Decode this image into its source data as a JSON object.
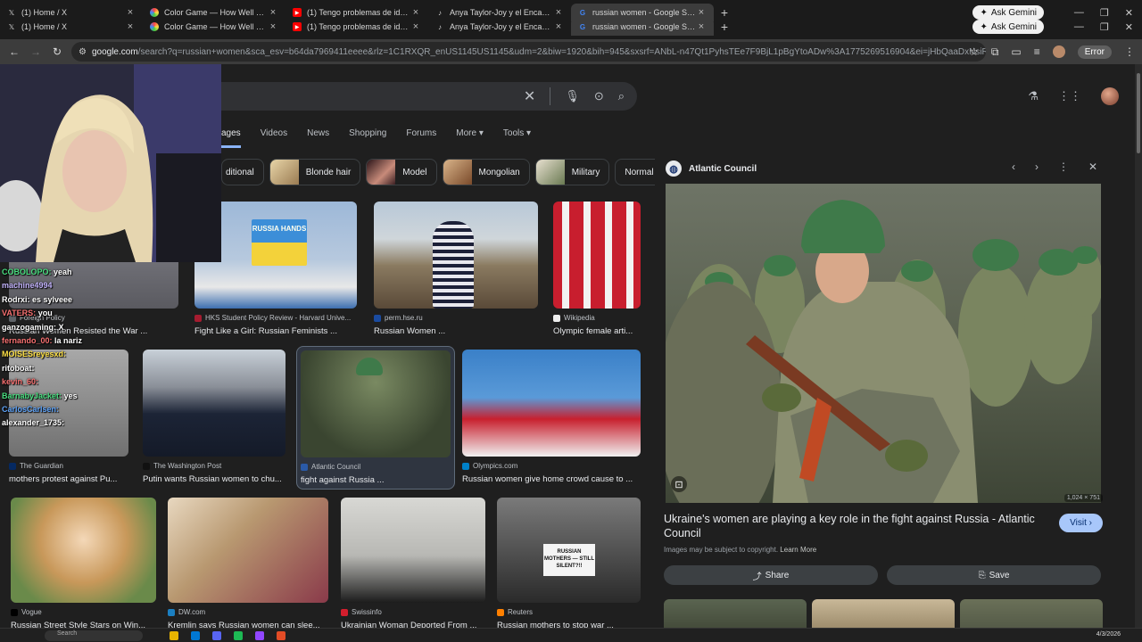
{
  "tabs": [
    {
      "title": "(1) Home / X",
      "icon": "x-logo-icon"
    },
    {
      "title": "Color Game — How Well Can Y",
      "icon": "color-game-icon"
    },
    {
      "title": "(1) Tengo problemas de identi",
      "icon": "youtube-icon"
    },
    {
      "title": "Anya Taylor-Joy y el Encanto d",
      "icon": "tiktok-icon"
    },
    {
      "title": "russian women - Google Search",
      "icon": "google-icon",
      "active": true
    }
  ],
  "ask_gemini": "Ask Gemini",
  "address": {
    "host": "google.com",
    "rest": "/search?q=russian+women&sca_esv=b64da7969411eeee&rlz=1C1RXQR_enUS1145US1145&udm=2&biw=1920&bih=945&sxsrf=ANbL-n47Qt1PyhsTEe7F9BjL1pBgYtoADw%3A1775269516904&ei=jHbQaaDxNsiRwbkP5LC..."
  },
  "error_label": "Error",
  "filters": [
    "Images",
    "Videos",
    "News",
    "Shopping",
    "Forums",
    "More",
    "Tools"
  ],
  "filter_visible_active": "ages",
  "chips": [
    {
      "label": "ditional",
      "color": "#8a6a4a"
    },
    {
      "label": "Blonde hair",
      "color": "#d8c7a0"
    },
    {
      "label": "Model",
      "color": "#4a2a30"
    },
    {
      "label": "Mongolian",
      "color": "#b58a5a"
    },
    {
      "label": "Military",
      "color": "#5a6a4a"
    },
    {
      "label": "Normal",
      "color": "#333"
    }
  ],
  "results_row1": [
    {
      "source": "Foreign Policy",
      "caption": "Russian Women Resisted the War ..."
    },
    {
      "source": "HKS Student Policy Review - Harvard Unive...",
      "caption": "Fight Like a Girl: Russian Feminists ..."
    },
    {
      "source": "perm.hse.ru",
      "caption": "Russian Women ..."
    },
    {
      "source": "Wikipedia",
      "caption": "Olympic female arti..."
    }
  ],
  "results_row2": [
    {
      "source": "The Guardian",
      "caption": "mothers protest against Pu..."
    },
    {
      "source": "The Washington Post",
      "caption": "Putin wants Russian women to chu..."
    },
    {
      "source": "Atlantic Council",
      "caption": "fight against Russia ..."
    },
    {
      "source": "Olympics.com",
      "caption": "Russian women give home crowd cause to ..."
    }
  ],
  "results_row3": [
    {
      "source": "Vogue",
      "caption": "Russian Street Style Stars on Win..."
    },
    {
      "source": "DW.com",
      "caption": "Kremlin says Russian women can slee..."
    },
    {
      "source": "Swissinfo",
      "caption": "Ukrainian Woman Deported From ..."
    },
    {
      "source": "Reuters",
      "caption": "Russian mothers to stop war ..."
    }
  ],
  "sign_text": "RUSSIAN MOTHERS — STILL SILENT?!!",
  "flag_sign": "RUSSIA HANDS",
  "preview": {
    "source": "Atlantic Council",
    "dimensions": "1,024 × 751",
    "title": "Ukraine's women are playing a key role in the fight against Russia - Atlantic Council",
    "visit": "Visit",
    "copyright": "Images may be subject to copyright.",
    "learn_more": "Learn More",
    "share": "Share",
    "save": "Save"
  },
  "chat": [
    {
      "user": "COBOLOPO:",
      "text": "yeah",
      "ucolor": "#4ade80"
    },
    {
      "user": "machine4994",
      "text": "",
      "ucolor": "#c4b5fd"
    },
    {
      "user": "Rodrxi:",
      "text": "es sylveee",
      "ucolor": "#ffffff"
    },
    {
      "user": "VATERS:",
      "text": "you",
      "ucolor": "#f87171"
    },
    {
      "user": "ganzogaming:",
      "text": "X",
      "ucolor": "#ffffff"
    },
    {
      "user": "fernando_00:",
      "text": "la nariz",
      "ucolor": "#f87171"
    },
    {
      "user": "MOISESreyesxd:",
      "text": "",
      "ucolor": "#fde047"
    },
    {
      "user": "ritoboat:",
      "text": "",
      "ucolor": "#ffffff"
    },
    {
      "user": "kevin_60:",
      "text": "",
      "ucolor": "#f87171"
    },
    {
      "user": "BarnabyJacket:",
      "text": "yes",
      "ucolor": "#4ade80"
    },
    {
      "user": "CarlosCarlsen:",
      "text": "",
      "ucolor": "#60a5fa"
    },
    {
      "user": "alexander_1735:",
      "text": "",
      "ucolor": "#ffffff"
    }
  ],
  "clock": "4/3/2026",
  "taskbar_search": "Search"
}
